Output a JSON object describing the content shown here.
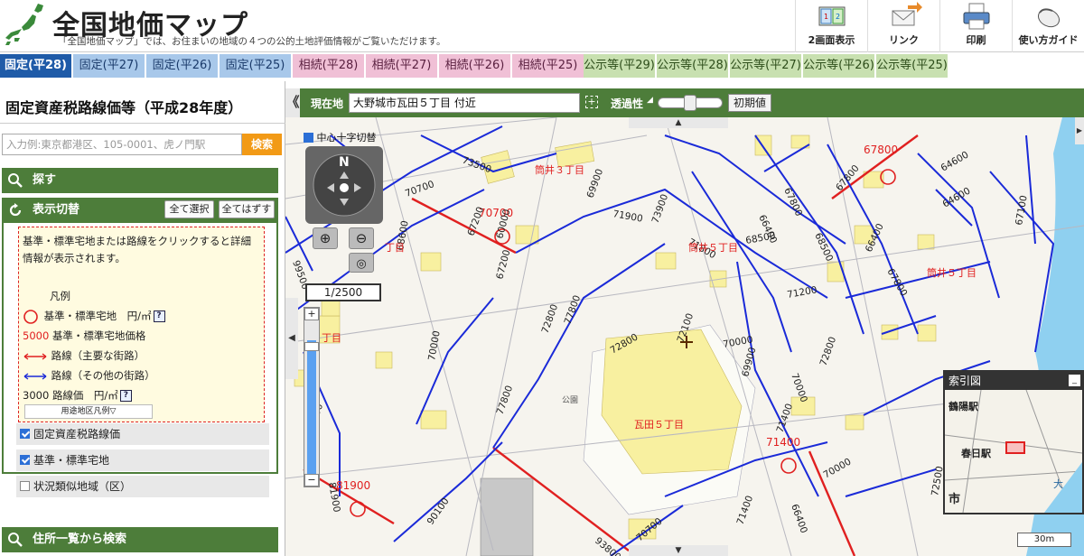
{
  "header": {
    "title": "全国地価マップ",
    "subtitle": "「全国地価マップ」では、お住まいの地域の４つの公的土地評価情報がご覧いただけます。",
    "tools": [
      {
        "label": "2画面表示",
        "icon": "dual-screen-icon"
      },
      {
        "label": "リンク",
        "icon": "link-mail-icon"
      },
      {
        "label": "印刷",
        "icon": "printer-icon"
      },
      {
        "label": "使い方ガイド",
        "icon": "mouse-guide-icon"
      }
    ]
  },
  "tabs": [
    {
      "label": "固定(平28)",
      "kind": "fix",
      "active": true
    },
    {
      "label": "固定(平27)",
      "kind": "fix"
    },
    {
      "label": "固定(平26)",
      "kind": "fix"
    },
    {
      "label": "固定(平25)",
      "kind": "fix"
    },
    {
      "label": "相続(平28)",
      "kind": "sz"
    },
    {
      "label": "相続(平27)",
      "kind": "sz"
    },
    {
      "label": "相続(平26)",
      "kind": "sz"
    },
    {
      "label": "相続(平25)",
      "kind": "sz"
    },
    {
      "label": "公示等(平29)",
      "kind": "ko"
    },
    {
      "label": "公示等(平28)",
      "kind": "ko"
    },
    {
      "label": "公示等(平27)",
      "kind": "ko"
    },
    {
      "label": "公示等(平26)",
      "kind": "ko"
    },
    {
      "label": "公示等(平25)",
      "kind": "ko"
    }
  ],
  "left_panel": {
    "title": "固定資産税路線価等（平成28年度）",
    "search_placeholder": "入力例:東京都港区、105-0001、虎ノ門駅",
    "search_button": "検索",
    "sections": {
      "search": "探す",
      "display": "表示切替",
      "address_list": "住所一覧から検索"
    },
    "select_all": "全て選択",
    "deselect_all": "全てはずす",
    "legend": {
      "intro": "基準・標準宅地または路線をクリックすると詳細情報が表示されます。",
      "heading": "凡例",
      "std_land": "基準・標準宅地　円/㎡",
      "price_sample": "5000",
      "price_label": "基準・標準宅地価格",
      "road_main": "路線（主要な街路）",
      "road_other": "路線（その他の街路）",
      "road_price_sample": "3000",
      "road_price_label": "路線価　円/㎡",
      "help": "?",
      "zoning_button": "用途地区凡例▽"
    },
    "layers": [
      {
        "label": "固定資産税路線価",
        "checked": true
      },
      {
        "label": "基準・標準宅地",
        "checked": true
      },
      {
        "label": "状況類似地域（区）",
        "checked": false
      }
    ]
  },
  "map_bar": {
    "location_label": "現在地",
    "location_value": "大野城市瓦田５丁目 付近",
    "opacity_label": "透過性",
    "reset_button": "初期値",
    "collapse": "《",
    "crosshair_toggle": "中心十字切替"
  },
  "map": {
    "scale": "1/2500",
    "compass": "N",
    "scalebar": "30m",
    "inset_title": "索引図",
    "inset_stations": [
      "鶴陽駅",
      "春日駅"
    ],
    "inset_labels": [
      "市",
      "大"
    ],
    "districts": [
      "瓦田５丁目",
      "筒井３丁目",
      "筒井５丁目",
      "筒井５丁目",
      "丁目",
      "丁目",
      "公園"
    ],
    "std_prices": [
      "70700",
      "67800",
      "71400",
      "81900"
    ],
    "road_prices": [
      "73500",
      "70700",
      "69900",
      "71900",
      "73900",
      "71800",
      "68500",
      "66400",
      "67800",
      "66400",
      "67800",
      "68500",
      "64600",
      "64600",
      "67100",
      "71200",
      "67200",
      "72800",
      "77800",
      "70000",
      "72800",
      "72100",
      "70000",
      "69900",
      "70000",
      "72800",
      "71400",
      "77800",
      "63500",
      "81900",
      "90100",
      "93800",
      "70700",
      "66400",
      "71400",
      "60000",
      "67200",
      "68600",
      "99500",
      "72500",
      "70000",
      "70700"
    ]
  },
  "colors": {
    "header_green": "#4d7d3a",
    "active_tab": "#1f5ba8",
    "road_main": "#e02020",
    "road_other": "#1a2ad8",
    "search_button": "#f29a16"
  }
}
